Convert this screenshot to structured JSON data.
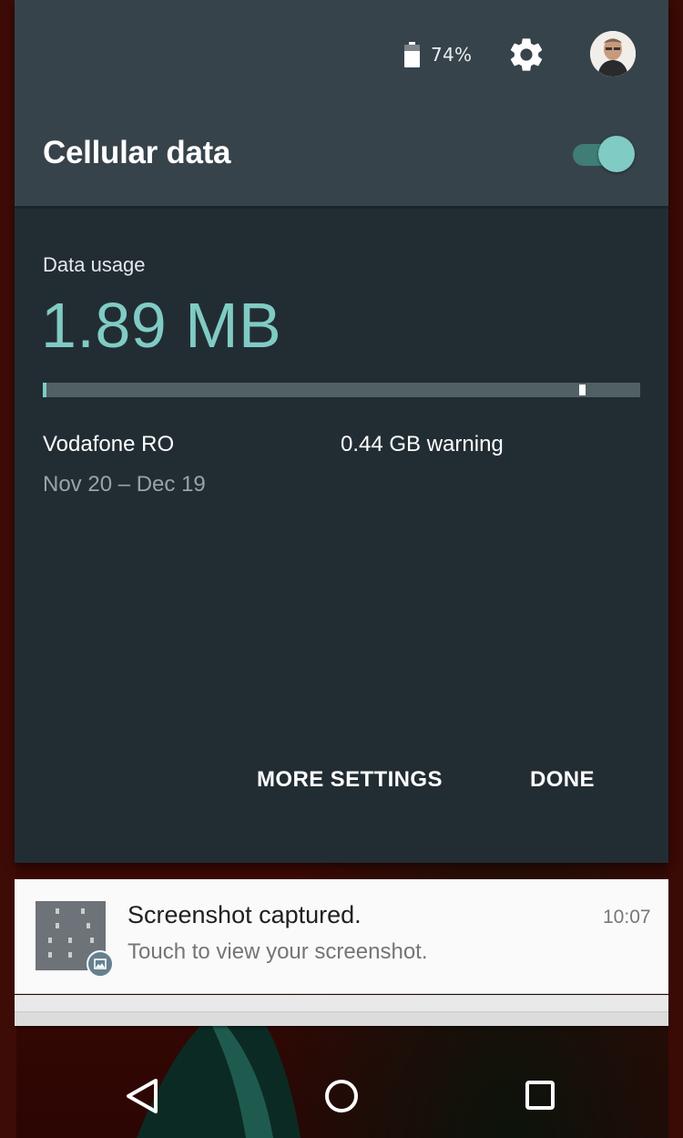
{
  "status": {
    "battery_text": "74%",
    "battery_level": 0.74
  },
  "quick_settings": {
    "title": "Cellular data",
    "toggle_on": true
  },
  "data_usage": {
    "label": "Data usage",
    "value": "1.89 MB",
    "used_fraction": 0.004,
    "warning_fraction": 0.898,
    "carrier": "Vodafone RO",
    "warning": "0.44 GB warning",
    "period": "Nov 20 – Dec 19"
  },
  "actions": {
    "more_settings": "MORE SETTINGS",
    "done": "DONE"
  },
  "notification": {
    "title": "Screenshot captured.",
    "text": "Touch to view your screenshot.",
    "time": "10:07"
  },
  "icons": {
    "settings": "gear-icon",
    "back": "back-icon",
    "home": "home-icon",
    "recents": "recents-icon"
  },
  "colors": {
    "accent": "#80cbc4",
    "panel_bg": "#222d33",
    "header_bg": "#37434a"
  }
}
